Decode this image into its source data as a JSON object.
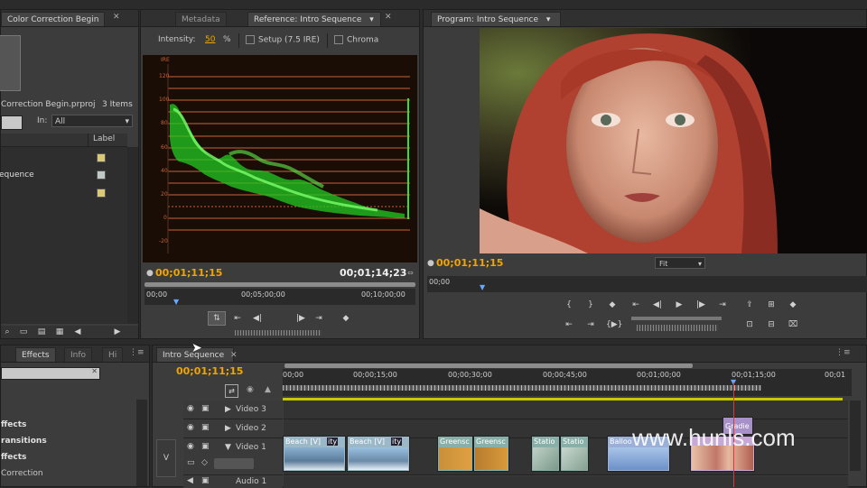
{
  "project_panel": {
    "tab": "Color Correction Begin",
    "project_file": "Correction Begin.prproj",
    "item_count": "3 Items",
    "in_label": "In:",
    "in_value": "All",
    "label_header": "Label",
    "items": [
      {
        "name": "",
        "swatch": "#d8c878"
      },
      {
        "name": "equence",
        "swatch": "#c0c8c8"
      },
      {
        "name": "",
        "swatch": "#d8c878"
      }
    ]
  },
  "reference_monitor": {
    "tabs": [
      "Metadata",
      "Reference: Intro Sequence"
    ],
    "intensity_label": "Intensity:",
    "intensity_value": "50",
    "intensity_unit": "%",
    "setup_label": "Setup (7.5 IRE)",
    "chroma_label": "Chroma",
    "scope_unit": "IRE",
    "scope_ticks": [
      "120",
      "100",
      "80",
      "60",
      "40",
      "20",
      "0",
      "-20"
    ],
    "timecode_current": "00;01;11;15",
    "timecode_duration": "00;01;14;23",
    "ruler": [
      "00;00",
      "00;05;00;00",
      "00;10;00;00"
    ]
  },
  "program_monitor": {
    "tab": "Program: Intro Sequence",
    "timecode_current": "00;01;11;15",
    "zoom": "Fit",
    "ruler": [
      "00;00"
    ]
  },
  "effects_panel": {
    "tabs": [
      "Effects",
      "Info",
      "Hi"
    ],
    "items": [
      "ffects",
      "ransitions",
      "ffects",
      "Correction"
    ]
  },
  "timeline": {
    "tab": "Intro Sequence",
    "timecode": "00;01;11;15",
    "ruler": [
      "00;00",
      "00;00;15;00",
      "00;00;30;00",
      "00;00;45;00",
      "00;01;00;00",
      "00;01;15;00",
      "00;01"
    ],
    "tracks": [
      "Video 3",
      "Video 2",
      "Video 1",
      "Audio 1"
    ],
    "v_label": "V",
    "clips": [
      {
        "name": "Beach [V]",
        "extra": "ity",
        "thumb": "#5a7c9a"
      },
      {
        "name": "Beach [V]",
        "extra": "ity",
        "thumb": "#6a8aa8"
      },
      {
        "name": "Greensc",
        "extra": "",
        "thumb": "#c8903a"
      },
      {
        "name": "Greensc",
        "extra": "",
        "thumb": "#b87c30"
      },
      {
        "name": "Statio",
        "extra": "",
        "thumb": "#7a9a8a"
      },
      {
        "name": "Statio",
        "extra": "",
        "thumb": "#84a090"
      },
      {
        "name": "Balloo",
        "extra": "",
        "thumb": "#6c90c8"
      },
      {
        "name": "Gradie",
        "extra": "",
        "thumb": "#c07868"
      }
    ]
  },
  "watermark": "www.hunls.com"
}
